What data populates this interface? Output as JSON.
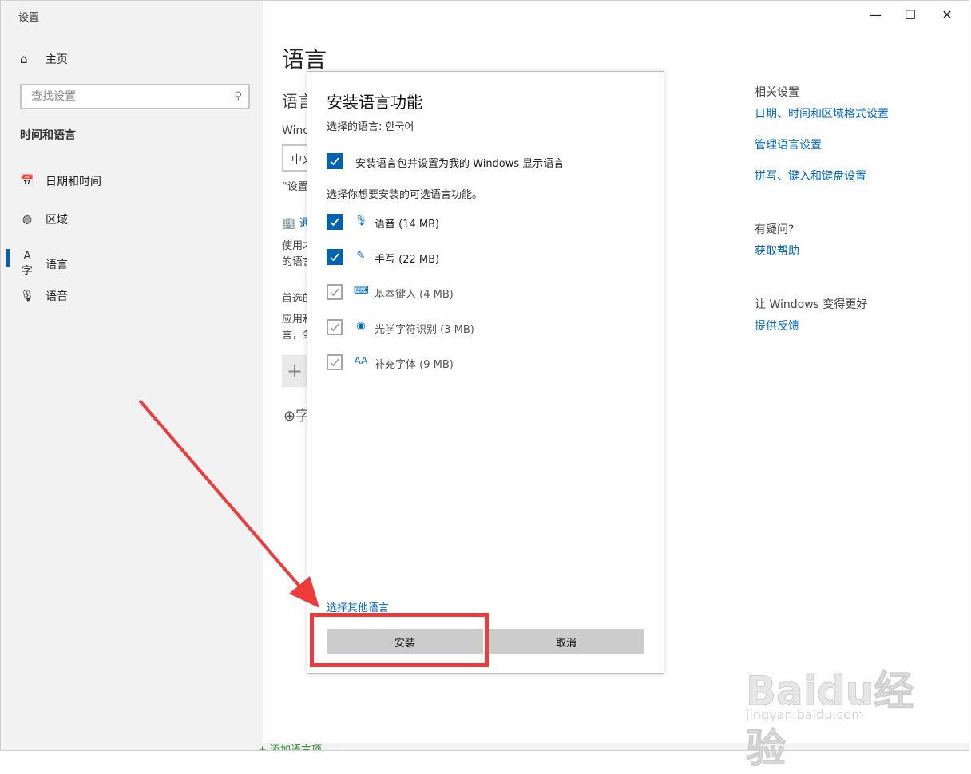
{
  "window": {
    "title": "设置",
    "controls": {
      "minimize": "—",
      "maximize": "☐",
      "close": "✕"
    }
  },
  "sidebar": {
    "home_label": "主页",
    "search_placeholder": "查找设置",
    "section_title": "时间和语言",
    "items": [
      {
        "label": "日期和时间",
        "icon": "calendar-clock-icon"
      },
      {
        "label": "区域",
        "icon": "globe-icon"
      },
      {
        "label": "语言",
        "icon": "language-icon",
        "active": true
      },
      {
        "label": "语音",
        "icon": "microphone-icon"
      }
    ]
  },
  "main": {
    "title": "语言",
    "fragments": {
      "lang_heading": "语言",
      "windows_label": "Wind",
      "dropdown_text": "中文",
      "settings_quote": "“设置",
      "link_frag": "通",
      "use_frag_1": "使用才",
      "use_frag_2": "的语言",
      "preferred_frag": "首选的",
      "app_frag_1": "应用和",
      "app_frag_2": "言，条",
      "plus": "+",
      "char_frag": "字",
      "bottom_frag": "+ 添加语言项"
    }
  },
  "related": {
    "heading": "相关设置",
    "links": [
      "日期、时间和区域格式设置",
      "管理语言设置",
      "拼写、键入和键盘设置"
    ],
    "question_heading": "有疑问?",
    "help_link": "获取帮助",
    "improve_heading": "让 Windows 变得更好",
    "feedback_link": "提供反馈"
  },
  "dialog": {
    "title": "安装语言功能",
    "selected_language": "选择的语言: 한국어",
    "display_lang_label": "安装语言包并设置为我的 Windows 显示语言",
    "optional_note": "选择你想要安装的可选语言功能。",
    "features": [
      {
        "label": "语音 (14 MB)",
        "icon": "microphone-icon",
        "checked": true
      },
      {
        "label": "手写 (22 MB)",
        "icon": "pen-icon",
        "checked": true
      },
      {
        "label": "基本键入 (4 MB)",
        "icon": "keyboard-icon",
        "checked": false
      },
      {
        "label": "光学字符识别 (3 MB)",
        "icon": "camera-icon",
        "checked": false
      },
      {
        "label": "补充字体 (9 MB)",
        "icon": "font-icon",
        "checked": false
      }
    ],
    "other_language_link": "选择其他语言",
    "install_button": "安装",
    "cancel_button": "取消"
  },
  "watermark": {
    "main": "Baidu经验",
    "sub": "jingyan.baidu.com"
  },
  "colors": {
    "accent": "#0063b1",
    "link": "#0067c0",
    "annotation": "#ef3b3b"
  }
}
